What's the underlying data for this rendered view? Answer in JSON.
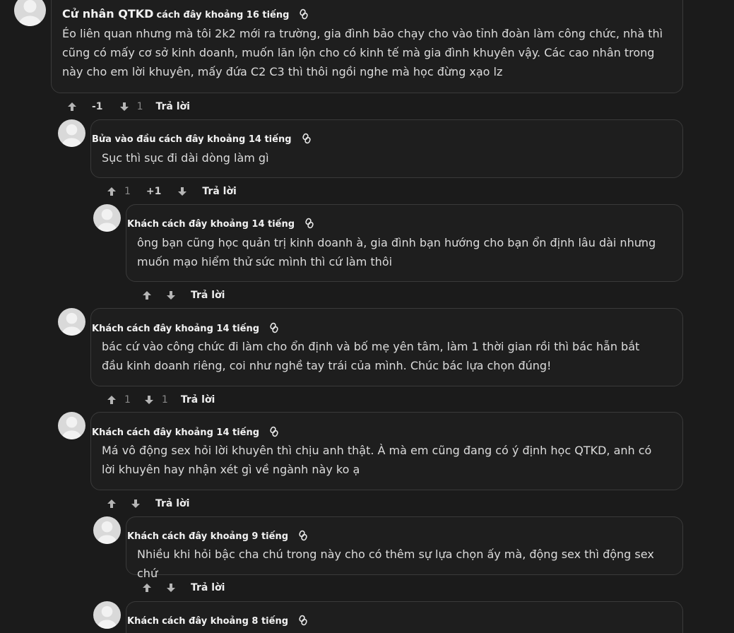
{
  "comments": [
    {
      "name": "Cử nhân QTKD",
      "time": "cách đây khoảng 16 tiếng",
      "text": "Éo liên quan nhưng mà tôi 2k2 mới ra trường, gia đình bảo chạy cho vào tỉnh đoàn làm công chức, nhà thì cũng có mấy cơ sở kinh doanh, muốn lăn lộn cho có kinh tế mà gia đình khuyên vậy. Các cao nhân trong này cho em lời khuyên, mấy đứa C2 C3 thì thôi ngồi nghe mà học đừng xạo lz",
      "score_up": "-1",
      "score_down": "1",
      "reply": "Trả lời"
    },
    {
      "name": "Bửa vào đầu",
      "time": "cách đây khoảng 14 tiếng",
      "text": "Sục thì sục đi dài dòng làm gì",
      "score_up": "1",
      "score_mid": "+1",
      "reply": "Trả lời"
    },
    {
      "name": "Khách",
      "time": "cách đây khoảng 14 tiếng",
      "text": "ông bạn cũng học quản trị kinh doanh à, gia đình bạn hướng cho bạn ổn định lâu dài nhưng muốn mạo hiểm thử sức mình thì cứ làm thôi",
      "reply": "Trả lời"
    },
    {
      "name": "Khách",
      "time": "cách đây khoảng 14 tiếng",
      "text": "bác cứ vào công chức đi làm cho ổn định và bố mẹ yên tâm, làm 1 thời gian rồi thì bác hẵn bắt đầu kinh doanh riêng, coi như nghề tay trái của mình. Chúc bác lựa chọn đúng!",
      "score_up": "1",
      "score_down": "1",
      "reply": "Trả lời"
    },
    {
      "name": "Khách",
      "time": "cách đây khoảng 14 tiếng",
      "text": "Má vô động sex hỏi lời khuyên thì chịu anh thật. À mà em cũng đang có ý định học QTKD, anh có lời khuyên hay nhận xét gì về ngành này ko ạ",
      "reply": "Trả lời"
    },
    {
      "name": "Khách",
      "time": "cách đây khoảng 9 tiếng",
      "text": "Nhiều khi hỏi bậc cha chú trong này cho có thêm sự lựa chọn ấy mà, động sex thì động sex chứ",
      "reply": "Trả lời"
    },
    {
      "name": "Khách",
      "time": "cách đây khoảng 8 tiếng"
    }
  ],
  "colors": {
    "background": "#1b1b1b",
    "border": "#3a3a3a",
    "text": "#dcdcdc"
  }
}
